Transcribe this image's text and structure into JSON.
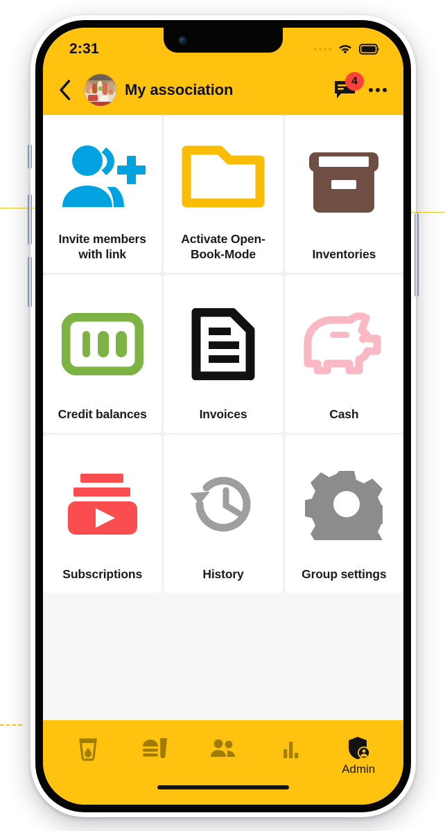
{
  "theme": {
    "brand_yellow": "#FFC20E",
    "tile_bg": "#FFFFFF",
    "page_bg": "#F1F1F1",
    "badge_red": "#F9423A",
    "text_dark": "#1B1B1B"
  },
  "status_bar": {
    "clock": "2:31",
    "signal_icon": "signal-dots-icon",
    "wifi_icon": "wifi-icon",
    "battery_icon": "battery-full-icon"
  },
  "app_bar": {
    "back_icon": "chevron-left-icon",
    "avatar_icon": "group-photo-avatar",
    "title": "My association",
    "chat_icon": "chat-bubble-icon",
    "chat_badge_count": "4",
    "overflow_icon": "more-horizontal-icon"
  },
  "grid": {
    "tiles": [
      {
        "label": "Invite members with link",
        "icon": "person-add-icon",
        "color": "#00A3E0"
      },
      {
        "label": "Activate Open-Book-Mode",
        "icon": "open-folder-icon",
        "color": "#FBBC04"
      },
      {
        "label": "Inventories",
        "icon": "inventory-box-icon",
        "color": "#6F4F43"
      },
      {
        "label": "Credit balances",
        "icon": "banknote-100-icon",
        "color": "#7CB342"
      },
      {
        "label": "Invoices",
        "icon": "invoice-document-icon",
        "color": "#111111"
      },
      {
        "label": "Cash",
        "icon": "piggy-bank-icon",
        "color": "#F9B8C4"
      },
      {
        "label": "Subscriptions",
        "icon": "subscriptions-play-icon",
        "color": "#FA4D50"
      },
      {
        "label": "History",
        "icon": "history-clock-icon",
        "color": "#9E9E9E"
      },
      {
        "label": "Group settings",
        "icon": "gear-icon",
        "color": "#8C8C8C"
      }
    ]
  },
  "bottom_nav": {
    "items": [
      {
        "label": "",
        "icon": "drink-glass-icon",
        "active": false
      },
      {
        "label": "",
        "icon": "food-burger-icon",
        "active": false
      },
      {
        "label": "",
        "icon": "people-icon",
        "active": false
      },
      {
        "label": "",
        "icon": "bar-chart-icon",
        "active": false
      },
      {
        "label": "Admin",
        "icon": "admin-shield-icon",
        "active": true
      }
    ]
  }
}
